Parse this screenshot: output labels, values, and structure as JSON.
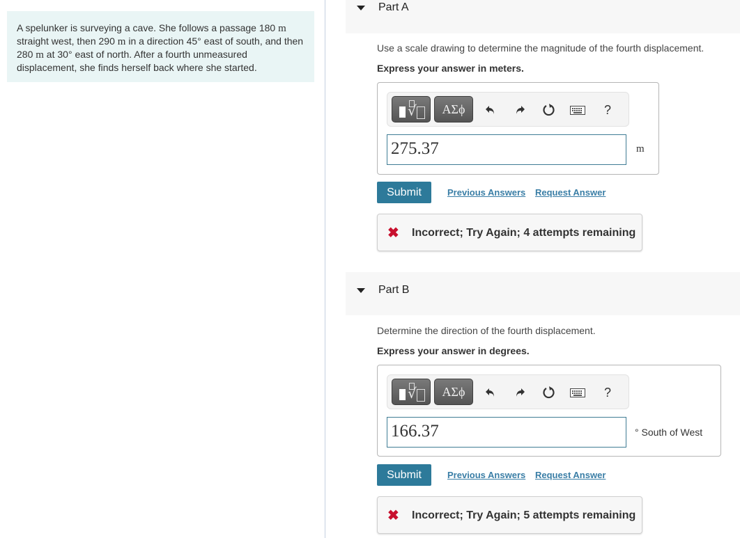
{
  "problem": {
    "segments": [
      {
        "t": "A spelunker is surveying a cave. She follows a passage 180 ",
        "serif": false
      },
      {
        "t": "m",
        "serif": true
      },
      {
        "t": " straight west, then 290 ",
        "serif": false
      },
      {
        "t": "m",
        "serif": true
      },
      {
        "t": " in a direction 45° east of south, and then 280 ",
        "serif": false
      },
      {
        "t": "m",
        "serif": true
      },
      {
        "t": " at 30° east of north. After a fourth unmeasured displacement, she finds herself back where she started.",
        "serif": false
      }
    ]
  },
  "toolbar": {
    "template_icon": "square-root-template-icon",
    "greek_label": "ΑΣϕ",
    "undo_icon": "undo-icon",
    "redo_icon": "redo-icon",
    "reset_icon": "reset-icon",
    "keyboard_icon": "keyboard-icon",
    "help_label": "?"
  },
  "parts": [
    {
      "title": "Part A",
      "prompt": "Use a scale drawing to determine the magnitude of the fourth displacement.",
      "instruction": "Express your answer in meters.",
      "answer_value": "275.37",
      "unit": "m",
      "submit_label": "Submit",
      "previous_answers_label": "Previous Answers",
      "request_answer_label": "Request Answer",
      "feedback": "Incorrect; Try Again; 4 attempts remaining"
    },
    {
      "title": "Part B",
      "prompt": "Determine the direction of the fourth displacement.",
      "instruction": "Express your answer in degrees.",
      "answer_value": "166.37",
      "unit": "° South of West",
      "submit_label": "Submit",
      "previous_answers_label": "Previous Answers",
      "request_answer_label": "Request Answer",
      "feedback": "Incorrect; Try Again; 5 attempts remaining"
    }
  ],
  "colors": {
    "problem_bg": "#e9f5f5",
    "submit_bg": "#2d7a9a",
    "link": "#3a7ea6",
    "error": "#c8102e"
  }
}
